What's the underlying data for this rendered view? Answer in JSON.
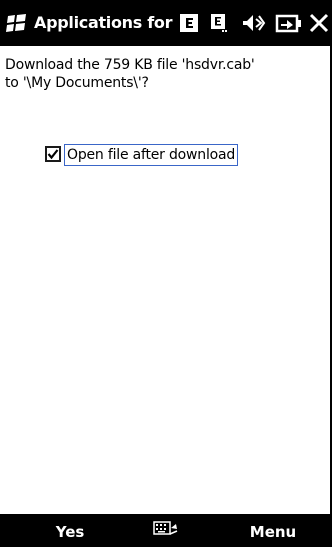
{
  "title_bar": {
    "title": "Applications for Ac",
    "icons": [
      "windows-start-icon",
      "edge-data-icon",
      "signal-icon",
      "volume-muted-icon",
      "battery-charging-icon",
      "close-icon"
    ]
  },
  "dialog": {
    "message_line1": "Download the 759 KB file 'hsdvr.cab'",
    "message_line2": "to '\\My Documents\\'?",
    "checkbox_label": "Open file after download",
    "checkbox_checked": true
  },
  "softkeys": {
    "left_label": "Yes",
    "center_icon": "keyboard-icon",
    "right_label": "Menu"
  },
  "colors": {
    "bar_background": "#000000",
    "bar_text": "#ffffff",
    "focus_border": "#3a66c8"
  }
}
